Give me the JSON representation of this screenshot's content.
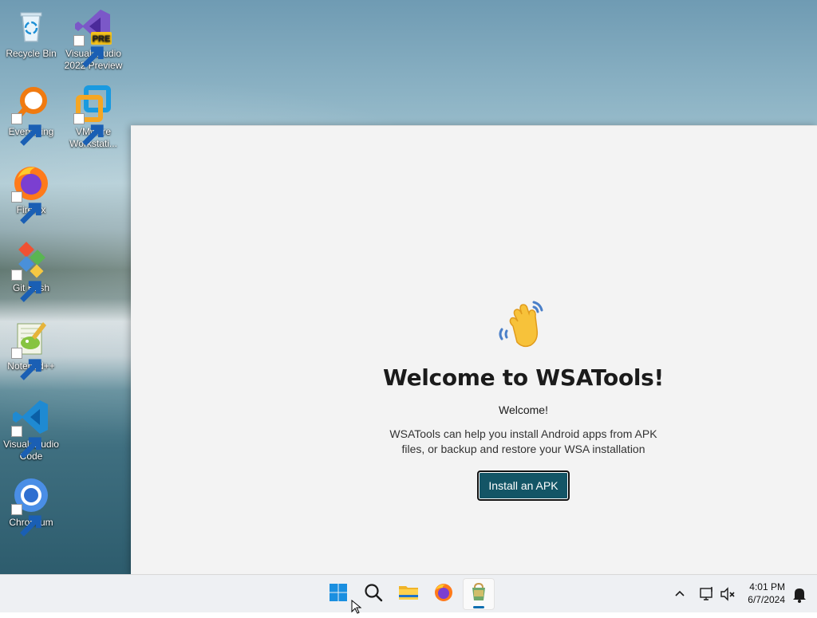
{
  "desktop": {
    "icons": [
      {
        "label": "Recycle Bin",
        "icon": "recycle-bin-icon"
      },
      {
        "label": "Visual Studio 2022 Preview",
        "icon": "visual-studio-icon",
        "badge": "PRE"
      },
      {
        "label": "Everything",
        "icon": "everything-search-icon"
      },
      {
        "label": "VMware Workstati...",
        "icon": "vmware-icon"
      },
      {
        "label": "Firefox",
        "icon": "firefox-icon"
      },
      {
        "label": "Git Bash",
        "icon": "git-bash-icon"
      },
      {
        "label": "Notepad++",
        "icon": "notepad-plus-plus-icon"
      },
      {
        "label": "Visual Studio Code",
        "icon": "vscode-icon"
      },
      {
        "label": "Chromium",
        "icon": "chromium-icon"
      }
    ]
  },
  "app": {
    "title": "Welcome to WSATools!",
    "subtitle": "Welcome!",
    "description": "WSATools can help you install Android apps from APK files, or backup and restore your WSA installation",
    "install_button": "Install an APK",
    "hand_icon": "waving-hand-icon",
    "accent": "#135566"
  },
  "taskbar": {
    "items": [
      "start-icon",
      "search-icon",
      "file-explorer-icon",
      "firefox-icon",
      "wsatools-icon"
    ],
    "active": "wsatools-icon",
    "tray": {
      "chevron": "show-hidden-icons-chevron",
      "network": "network-icon",
      "volume": "volume-muted-icon",
      "notifications": "notification-bell-icon"
    },
    "time": "4:01 PM",
    "date": "6/7/2024"
  }
}
